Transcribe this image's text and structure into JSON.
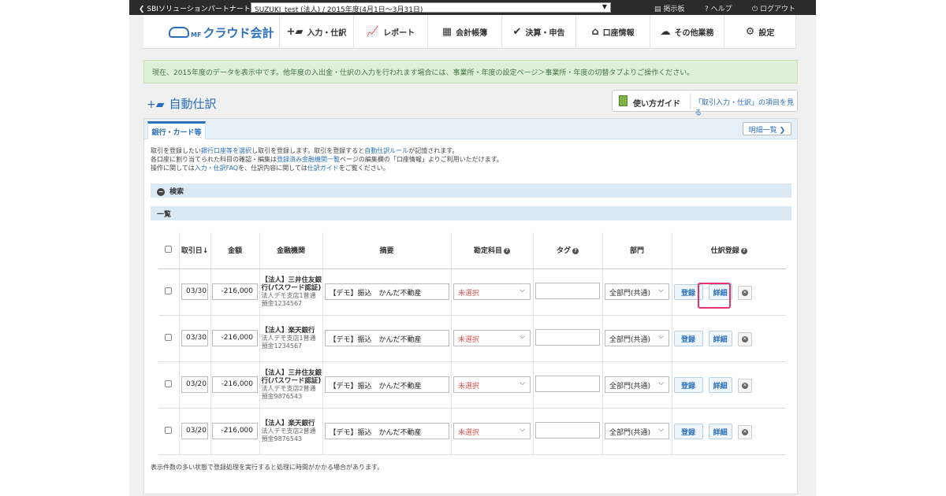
{
  "topbar": {
    "back_label": "SBIソリューションパートナートップ",
    "business_select": "SUZUKI_test (法人) / 2015年度(4月1日〜3月31日)",
    "board": "掲示板",
    "help": "ヘルプ",
    "logout": "ログアウト"
  },
  "header": {
    "logo_prefix": "MF",
    "logo": "クラウド会計",
    "nav": [
      "入力・仕訳",
      "レポート",
      "会計帳簿",
      "決算・申告",
      "口座情報",
      "その他業務",
      "設定"
    ]
  },
  "alert": "現在、2015年度のデータを表示中です。他年度の入出金・仕訳の入力を行われます場合には、事業所・年度の設定ページ＞事業所・年度の切替タブよりご操作ください。",
  "page_title": "自動仕訳",
  "guide": {
    "label": "使い方ガイド",
    "link": "「取引入力・仕訳」の項目を見る"
  },
  "tab": "銀行・カード等",
  "statement_button": "明細一覧",
  "desc": {
    "l1a": "取引を登録したい",
    "l1b": "銀行口座等を選択",
    "l1c": "し取引を登録します。取引を登録すると",
    "l1d": "自動仕訳ルール",
    "l1e": "が記憶されます。",
    "l2a": "各口座に割り当てられた科目の確認・編集は",
    "l2b": "登録済み金融機関一覧",
    "l2c": "ページの編集欄の「口座情報」よりご利用いただけます。",
    "l3a": "操作に関しては",
    "l3b": "入力・仕訳FAQ",
    "l3c": "を、仕訳内容に関しては",
    "l3d": "仕訳ガイド",
    "l3e": "をご覧ください。"
  },
  "search_bar": "検索",
  "list_bar": "一覧",
  "table": {
    "headers": [
      "取引日",
      "金額",
      "金融機関",
      "摘要",
      "勘定科目",
      "タグ",
      "部門",
      "仕訳登録"
    ],
    "sort_arrow": "↓",
    "rows": [
      {
        "date": "03/30",
        "amount": "-216,000",
        "bank": "【法人】三井住友銀行(パスワード認証)",
        "branch": "法人デモ支店1普通",
        "account": "預金1234567",
        "memo": "【デモ】振込　かんだ不動産",
        "account_item": "未選択",
        "tag": "",
        "dept": "全部門(共通)",
        "register": "登録",
        "detail": "詳細"
      },
      {
        "date": "03/30",
        "amount": "-216,000",
        "bank": "【法人】楽天銀行",
        "branch": "法人デモ支店1普通",
        "account": "預金1234567",
        "memo": "【デモ】振込　かんだ不動産",
        "account_item": "未選択",
        "tag": "",
        "dept": "全部門(共通)",
        "register": "登録",
        "detail": "詳細"
      },
      {
        "date": "03/20",
        "amount": "-216,000",
        "bank": "【法人】三井住友銀行(パスワード認証)",
        "branch": "法人デモ支店2普通",
        "account": "預金9876543",
        "memo": "【デモ】振込　かんだ不動産",
        "account_item": "未選択",
        "tag": "",
        "dept": "全部門(共通)",
        "register": "登録",
        "detail": "詳細"
      },
      {
        "date": "03/20",
        "amount": "-216,000",
        "bank": "【法人】楽天銀行",
        "branch": "法人デモ支店2普通",
        "account": "預金9876543",
        "memo": "【デモ】振込　かんだ不動産",
        "account_item": "未選択",
        "tag": "",
        "dept": "全部門(共通)",
        "register": "登録",
        "detail": "詳細"
      }
    ]
  },
  "footnote": "表示件数の多い状態で登録処理を実行すると処理に時間がかかる場合があります。",
  "colors": {
    "accent": "#2a6fb8",
    "alert_bg": "#dff0d8",
    "highlight": "#e8336d",
    "unselected": "#d9534f"
  }
}
